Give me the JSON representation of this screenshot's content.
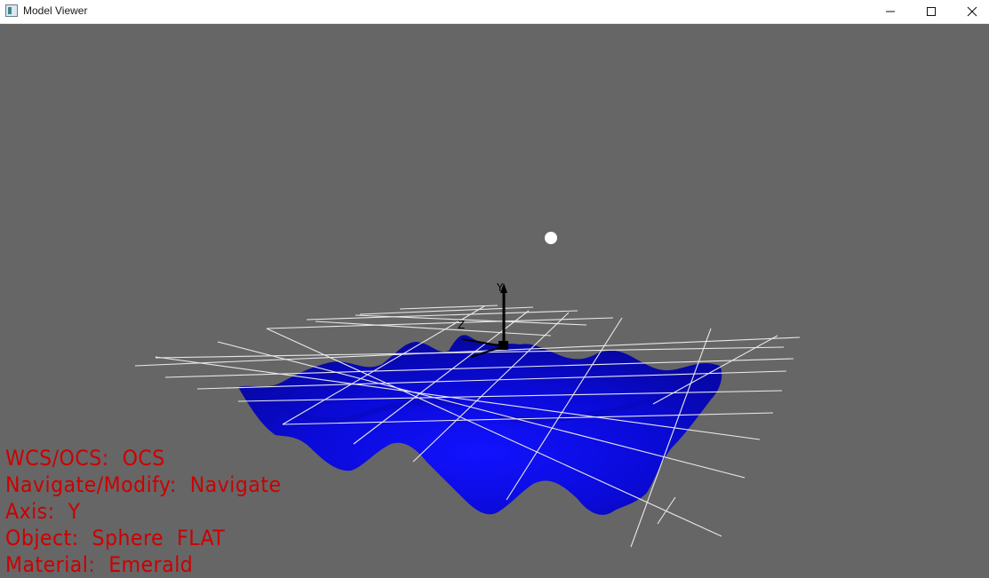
{
  "window": {
    "title": "Model Viewer",
    "controls": [
      "minimize",
      "maximize",
      "close"
    ]
  },
  "scene": {
    "background_color": "#666666",
    "surface_color": "#0a0ad8",
    "grid_color": "#ffffff",
    "axis_color": "#000000",
    "light_color": "#ffffff",
    "axis_labels": {
      "y": "Y",
      "z": "Z"
    }
  },
  "hud": {
    "color": "#cc0000",
    "lines": [
      "WCS/OCS:  OCS",
      "Navigate/Modify:  Navigate",
      "Axis:  Y",
      "Object:  Sphere  FLAT",
      "Material:  Emerald"
    ]
  }
}
